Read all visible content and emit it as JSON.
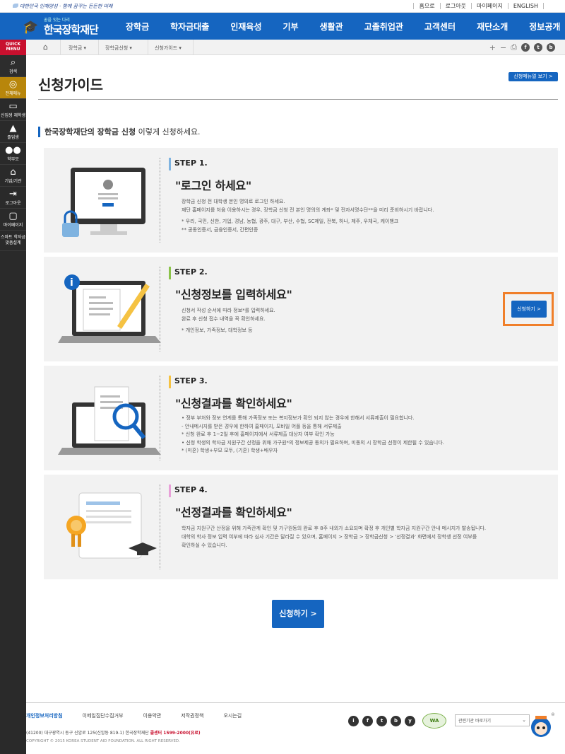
{
  "util": {
    "slogan": "대한민국 인재양성 · 함께 꿈꾸는 든든한 미래",
    "links": [
      "홈으로",
      "로그아웃",
      "마이페이지",
      "ENGLISH"
    ]
  },
  "logo": {
    "small": "꿈을 잇는 다리",
    "name": "한국장학재단"
  },
  "nav": [
    "장학금",
    "학자금대출",
    "인재육성",
    "기부",
    "생활관",
    "고졸취업관",
    "고객센터",
    "재단소개",
    "정보공개"
  ],
  "rail": {
    "quick_menu": "QUICK MENU",
    "items": [
      "검색",
      "전체메뉴",
      "신입생 재학생",
      "졸업생",
      "학부모",
      "기업/기관",
      "로그아웃",
      "마이페이지",
      "스마트 학자금 맞춤설계"
    ]
  },
  "breadcrumb": [
    "장학금",
    "장학금신청",
    "신청가이드"
  ],
  "page": {
    "title": "신청가이드",
    "menu_button": "신청메뉴얼 보기 >",
    "intro_bold": "한국장학재단의 장학금 신청",
    "intro_rest": " 이렇게 신청하세요."
  },
  "steps": [
    {
      "label": "STEP 1.",
      "head": "\"로그인 하세요\"",
      "bar": "#7fb3e0",
      "lines": [
        "장학금 신청 전 대학생 본인 명의로 로그인 하세요.",
        "재단 홈페이지를 처음 이용하시는 경우, 장학금 신청 전 본인 명의의 계좌* 및 전자서명수단**을 미리 준비하시기 바랍니다.",
        "* 우리, 국민, 신한, 기업, 경남, 농협, 광주, 대구, 부산, 수협, SC제일, 전북, 하나, 제주, 우체국, 케이뱅크",
        "** 공동인증서, 금융인증서, 간편인증"
      ]
    },
    {
      "label": "STEP 2.",
      "head": "\"신청정보를 입력하세요\"",
      "bar": "#8bc34a",
      "lines": [
        "신청서 작성 순서에 따라 정보*를 입력하세요.",
        "완료 후 신청 접수 내역을 꼭 확인하세요.",
        "* 개인정보, 가족정보, 대학정보 등"
      ],
      "button": "신청하기 >"
    },
    {
      "label": "STEP 3.",
      "head": "\"신청결과를 확인하세요\"",
      "bar": "#f5c242",
      "lines": [
        "• 정부 부처와 정보 연계를 통해 가족정보 또는 복지정보가 확인 되지 않는 경우에 한해서 서류제출이 필요합니다.",
        "  - 안내메시지를 받은 경우에 한하여 홈페이지, 모바일 어플 등을 통해 서류제출",
        "    * 신청 완료 후 1~2일 후에 홈페이지에서 서류제출 대상자 여부 확인 가능",
        "• 신청 학생의 학자금 지원구간 산정을 위해 가구원*의 정보제공 동의가 필요하며, 미동의 시 장학금 선정이 제한될 수 있습니다.",
        "  * (미혼) 학생+부모 모두, (기혼) 학생+배우자"
      ]
    },
    {
      "label": "STEP 4.",
      "head": "\"선정결과를 확인하세요\"",
      "bar": "#e8a0d8",
      "lines": [
        "학자금 지원구간 산정을 위해 가족관계 확인 및 가구원동의 완료 후 8주 내외가 소요되며 확정 후 개인별 학자금 지원구간 안내 메시지가 발송됩니다.",
        "대학의 학사 정보 입력 여부에 따라 심사 기간은 달라질 수 있으며, 홈페이지 > 장학금 > 장학금신청 > '선정결과' 화면에서 장학생 선정 여부를",
        "확인하실 수 있습니다."
      ]
    }
  ],
  "apply_button": "신청하기 >",
  "footer": {
    "links": [
      "개인정보처리방침",
      "이메일집단수집거부",
      "이용약관",
      "저작권정책",
      "오시는길"
    ],
    "address": "(41200) 대구광역시 동구 신암로 125(신암동 819-1) 한국장학재단 ",
    "callcenter": "콜센터 1599-2000(유료)",
    "copyright": "COPYRIGHT © 2015 KOREA STUDENT AID FOUNDATION. ALL RIGHT RESERVED.",
    "sns": [
      "i",
      "f",
      "t",
      "b",
      "y"
    ],
    "wa_mark": "WA",
    "select_placeholder": "관련기관 바로가기"
  },
  "colors": {
    "primary": "#1565c0",
    "highlight": "#f07f2a",
    "rail": "#2a2a2a"
  }
}
